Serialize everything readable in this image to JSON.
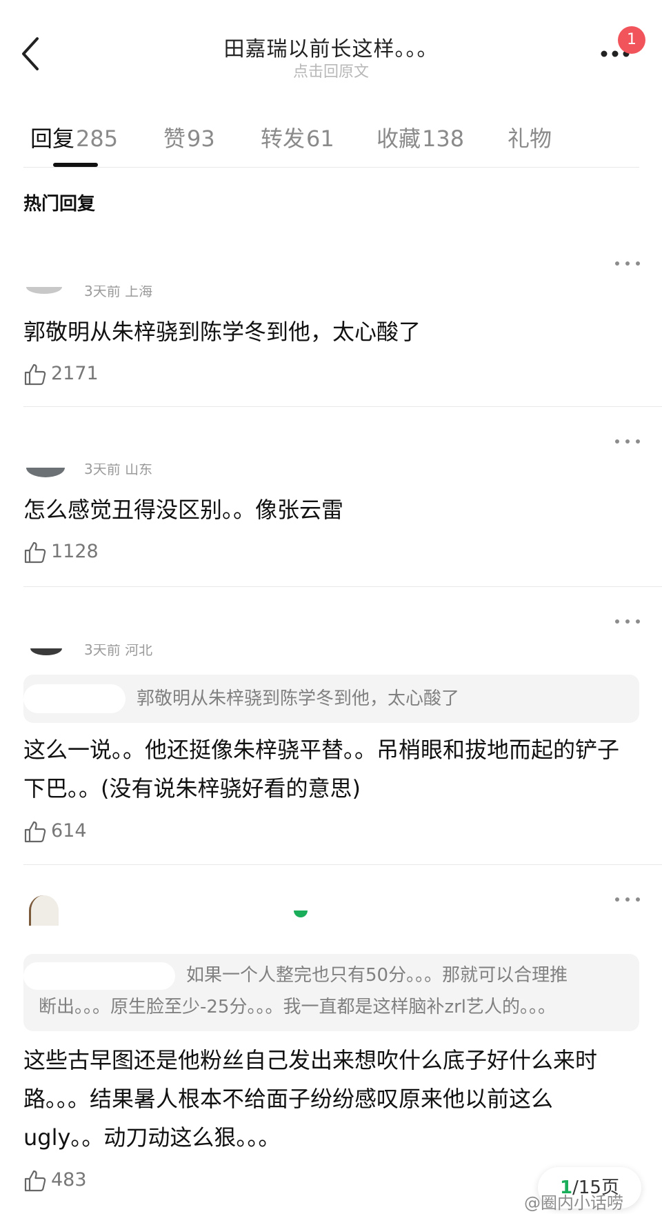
{
  "header": {
    "title": "田嘉瑞以前长这样。。。",
    "subtitle": "点击回原文",
    "badge_count": "1",
    "back_icon": "chevron-left-icon",
    "more_icon": "more-horizontal-icon"
  },
  "tabs": [
    {
      "label": "回复",
      "count": "285",
      "active": true
    },
    {
      "label": "赞",
      "count": "93",
      "active": false
    },
    {
      "label": "转发",
      "count": "61",
      "active": false
    },
    {
      "label": "收藏",
      "count": "138",
      "active": false
    },
    {
      "label": "礼物",
      "count": "",
      "active": false
    }
  ],
  "section_title": "热门回复",
  "comments": [
    {
      "meta": "3天前 上海",
      "text": "郭敬明从朱梓骁到陈学冬到他，太心酸了",
      "likes": "2171"
    },
    {
      "meta": "3天前 山东",
      "text": "怎么感觉丑得没区别。。像张云雷",
      "likes": "1128"
    },
    {
      "meta": "3天前 河北",
      "quote": "郭敬明从朱梓骁到陈学冬到他，太心酸了",
      "text": "这么一说。。他还挺像朱梓骁平替。。吊梢眼和拔地而起的铲子下巴。。(没有说朱梓骁好看的意思)",
      "likes": "614"
    },
    {
      "quote_line1": "如果一个人整完也只有50分。。。那就可以合理推",
      "quote_line2": "断出。。。原生脸至少-25分。。。我一直都是这样脑补zrl艺人的。。。",
      "text": "这些古早图还是他粉丝自己发出来想吹什么底子好什么来时路。。。结果暑人根本不给面子纷纷感叹原来他以前这么ugly。。动刀动这么狠。。。",
      "likes": "483"
    }
  ],
  "pager": {
    "current": "1",
    "total": "/15页"
  },
  "watermark": "@圈内小话唠",
  "colors": {
    "accent_green": "#1aad5a",
    "badge_red": "#f2545b",
    "text_gray": "#8a8a8a"
  }
}
